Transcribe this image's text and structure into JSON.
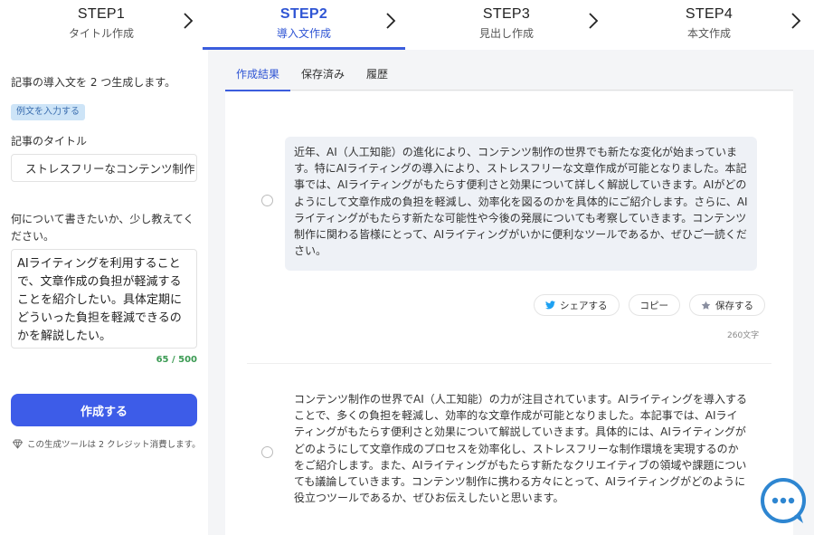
{
  "steps": [
    {
      "num": "STEP1",
      "name": "タイトル作成"
    },
    {
      "num": "STEP2",
      "name": "導入文作成"
    },
    {
      "num": "STEP3",
      "name": "見出し作成"
    },
    {
      "num": "STEP4",
      "name": "本文作成"
    }
  ],
  "left": {
    "description": "記事の導入文を 2 つ生成します。",
    "example_button": "例文を入力する",
    "title_label": "記事のタイトル",
    "title_value": "ストレスフリーなコンテンツ制作",
    "about_label": "何について書きたいか、少し教えてください。",
    "about_text": "AIライティングを利用することで、文章作成の負担が軽減することを紹介したい。具体定期にどういった負担を軽減できるのかを解説したい。",
    "counter": "65 / 500",
    "create_button": "作成する",
    "credit_note": "この生成ツールは 2 クレジット消費します。"
  },
  "tabs": [
    "作成結果",
    "保存済み",
    "履歴"
  ],
  "results": [
    {
      "text": "近年、AI（人工知能）の進化により、コンテンツ制作の世界でも新たな変化が始まっています。特にAIライティングの導入により、ストレスフリーな文章作成が可能となりました。本記事では、AIライティングがもたらす便利さと効果について詳しく解説していきます。AIがどのようにして文章作成の負担を軽減し、効率化を図るのかを具体的にご紹介します。さらに、AIライティングがもたらす新たな可能性や今後の発展についても考察していきます。コンテンツ制作に関わる皆様にとって、AIライティングがいかに便利なツールであるか、ぜひご一読ください。",
      "char_count": "260文字"
    },
    {
      "text": "コンテンツ制作の世界でAI（人工知能）の力が注目されています。AIライティングを導入することで、多くの負担を軽減し、効率的な文章作成が可能となりました。本記事では、AIライティングがもたらす便利さと効果について解説していきます。具体的には、AIライティングがどのようにして文章作成のプロセスを効率化し、ストレスフリーな制作環境を実現するのかをご紹介します。また、AIライティングがもたらす新たなクリエイティブの領域や課題についても議論していきます。コンテンツ制作に携わる方々にとって、AIライティングがどのように役立つツールであるか、ぜひお伝えしたいと思います。"
    }
  ],
  "actions": {
    "share": "シェアする",
    "copy": "コピー",
    "save": "保存する"
  },
  "icons": {
    "chevron": "chevron-right-icon",
    "gem": "diamond-icon",
    "share": "twitter-bird-icon",
    "save": "star-icon",
    "chat": "chat-bubble-icon"
  },
  "colors": {
    "accent": "#3d5ce8",
    "tab_accent": "#2f55d4",
    "counter": "#3a9a52",
    "chat": "#2e86d1",
    "twitter": "#1da1f2"
  }
}
